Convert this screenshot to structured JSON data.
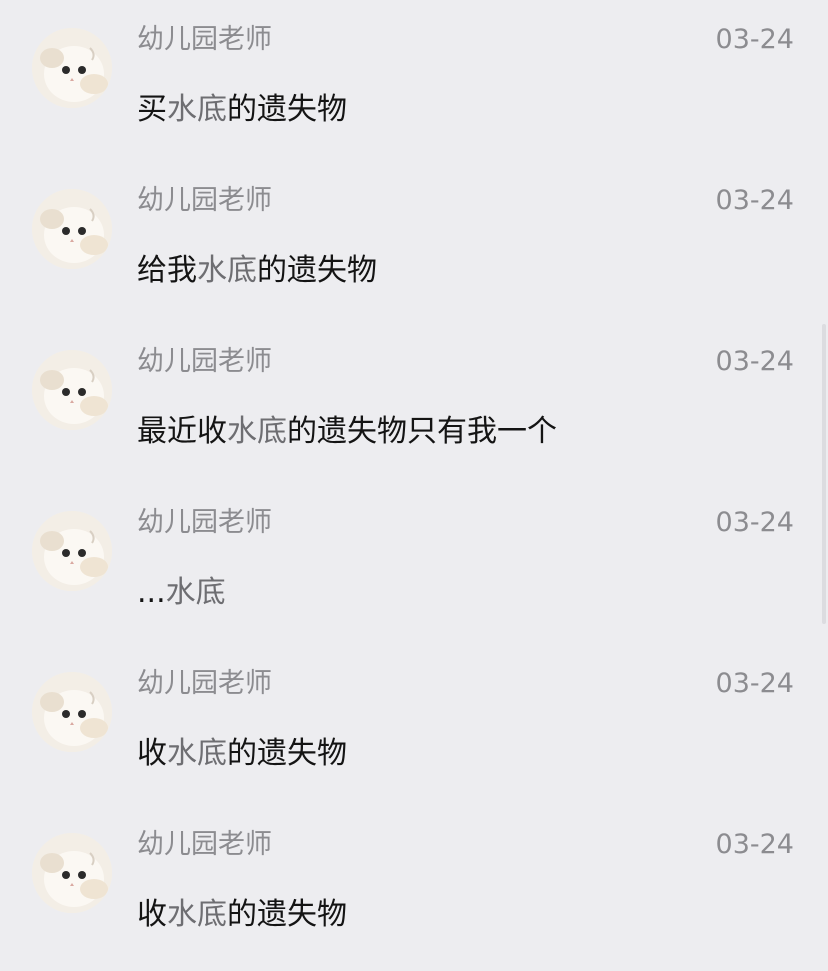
{
  "messages": [
    {
      "sender": "幼儿园老师",
      "date": "03-24",
      "pre": "买",
      "kw": "水底",
      "post": "的遗失物"
    },
    {
      "sender": "幼儿园老师",
      "date": "03-24",
      "pre": "给我",
      "kw": "水底",
      "post": "的遗失物"
    },
    {
      "sender": "幼儿园老师",
      "date": "03-24",
      "pre": "最近收",
      "kw": "水底",
      "post": "的遗失物只有我一个"
    },
    {
      "sender": "幼儿园老师",
      "date": "03-24",
      "pre": "...",
      "kw": "水底",
      "post": ""
    },
    {
      "sender": "幼儿园老师",
      "date": "03-24",
      "pre": "收",
      "kw": "水底",
      "post": "的遗失物"
    },
    {
      "sender": "幼儿园老师",
      "date": "03-24",
      "pre": "收",
      "kw": "水底",
      "post": "的遗失物"
    }
  ],
  "avatar_icon": "cat-avatar-icon",
  "colors": {
    "background": "#ededf0",
    "meta_text": "#8c8c90",
    "body_text": "#141414",
    "keyword_text": "#6e6e72"
  }
}
